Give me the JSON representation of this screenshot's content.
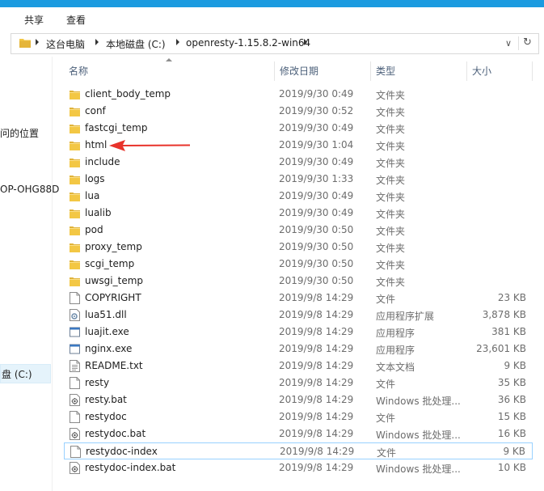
{
  "ribbon": {
    "tabs": [
      "共享",
      "查看"
    ]
  },
  "address": {
    "crumbs": [
      "这台电脑",
      "本地磁盘 (C:)",
      "openresty-1.15.8.2-win64"
    ]
  },
  "nav": {
    "items": [
      "问的位置",
      "OP-OHG88D",
      "盘 (C:)"
    ]
  },
  "columns": {
    "name": "名称",
    "date": "修改日期",
    "type": "类型",
    "size": "大小"
  },
  "files": [
    {
      "name": "client_body_temp",
      "date": "2019/9/30 0:49",
      "type": "文件夹",
      "size": "",
      "icon": "folder-icon"
    },
    {
      "name": "conf",
      "date": "2019/9/30 0:52",
      "type": "文件夹",
      "size": "",
      "icon": "folder-icon"
    },
    {
      "name": "fastcgi_temp",
      "date": "2019/9/30 0:49",
      "type": "文件夹",
      "size": "",
      "icon": "folder-icon"
    },
    {
      "name": "html",
      "date": "2019/9/30 1:04",
      "type": "文件夹",
      "size": "",
      "icon": "folder-icon"
    },
    {
      "name": "include",
      "date": "2019/9/30 0:49",
      "type": "文件夹",
      "size": "",
      "icon": "folder-icon"
    },
    {
      "name": "logs",
      "date": "2019/9/30 1:33",
      "type": "文件夹",
      "size": "",
      "icon": "folder-icon"
    },
    {
      "name": "lua",
      "date": "2019/9/30 0:49",
      "type": "文件夹",
      "size": "",
      "icon": "folder-icon"
    },
    {
      "name": "lualib",
      "date": "2019/9/30 0:49",
      "type": "文件夹",
      "size": "",
      "icon": "folder-icon"
    },
    {
      "name": "pod",
      "date": "2019/9/30 0:50",
      "type": "文件夹",
      "size": "",
      "icon": "folder-icon"
    },
    {
      "name": "proxy_temp",
      "date": "2019/9/30 0:50",
      "type": "文件夹",
      "size": "",
      "icon": "folder-icon"
    },
    {
      "name": "scgi_temp",
      "date": "2019/9/30 0:50",
      "type": "文件夹",
      "size": "",
      "icon": "folder-icon"
    },
    {
      "name": "uwsgi_temp",
      "date": "2019/9/30 0:50",
      "type": "文件夹",
      "size": "",
      "icon": "folder-icon"
    },
    {
      "name": "COPYRIGHT",
      "date": "2019/9/8 14:29",
      "type": "文件",
      "size": "23 KB",
      "icon": "file-icon"
    },
    {
      "name": "lua51.dll",
      "date": "2019/9/8 14:29",
      "type": "应用程序扩展",
      "size": "3,878 KB",
      "icon": "dll-icon"
    },
    {
      "name": "luajit.exe",
      "date": "2019/9/8 14:29",
      "type": "应用程序",
      "size": "381 KB",
      "icon": "exe-icon"
    },
    {
      "name": "nginx.exe",
      "date": "2019/9/8 14:29",
      "type": "应用程序",
      "size": "23,601 KB",
      "icon": "exe-icon"
    },
    {
      "name": "README.txt",
      "date": "2019/9/8 14:29",
      "type": "文本文档",
      "size": "9 KB",
      "icon": "text-file-icon"
    },
    {
      "name": "resty",
      "date": "2019/9/8 14:29",
      "type": "文件",
      "size": "35 KB",
      "icon": "file-icon"
    },
    {
      "name": "resty.bat",
      "date": "2019/9/8 14:29",
      "type": "Windows 批处理...",
      "size": "36 KB",
      "icon": "bat-icon"
    },
    {
      "name": "restydoc",
      "date": "2019/9/8 14:29",
      "type": "文件",
      "size": "15 KB",
      "icon": "file-icon"
    },
    {
      "name": "restydoc.bat",
      "date": "2019/9/8 14:29",
      "type": "Windows 批处理...",
      "size": "16 KB",
      "icon": "bat-icon"
    },
    {
      "name": "restydoc-index",
      "date": "2019/9/8 14:29",
      "type": "文件",
      "size": "9 KB",
      "icon": "file-icon"
    },
    {
      "name": "restydoc-index.bat",
      "date": "2019/9/8 14:29",
      "type": "Windows 批处理...",
      "size": "10 KB",
      "icon": "bat-icon"
    }
  ],
  "selected_row": 21,
  "colors": {
    "folder": "#f3c744",
    "folder_dark": "#dca92a",
    "arrow": "#e8332b",
    "selection": "#99d1ff",
    "titlebar": "#1b9be0"
  }
}
